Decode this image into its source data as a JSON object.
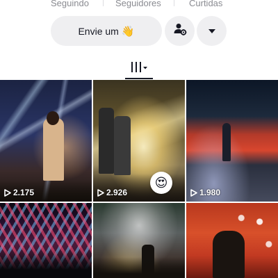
{
  "stats": {
    "following_label": "Seguindo",
    "followers_label": "Seguidores",
    "likes_label": "Curtidas"
  },
  "actions": {
    "message_label": "Envie um",
    "message_emoji": "👋",
    "friend_icon": "person-gear-icon",
    "more_icon": "triangle-down-icon"
  },
  "tabs": {
    "active_icon": "grid-bars-icon"
  },
  "videos": [
    {
      "views": "2.175",
      "reaction": ""
    },
    {
      "views": "2.926",
      "reaction": "😍"
    },
    {
      "views": "1.980",
      "reaction": ""
    },
    {
      "views": "",
      "reaction": ""
    },
    {
      "views": "",
      "reaction": ""
    },
    {
      "views": "",
      "reaction": ""
    }
  ],
  "colors": {
    "text_primary": "#161823",
    "text_muted": "#8a8b91",
    "button_bg": "#efeff1"
  }
}
